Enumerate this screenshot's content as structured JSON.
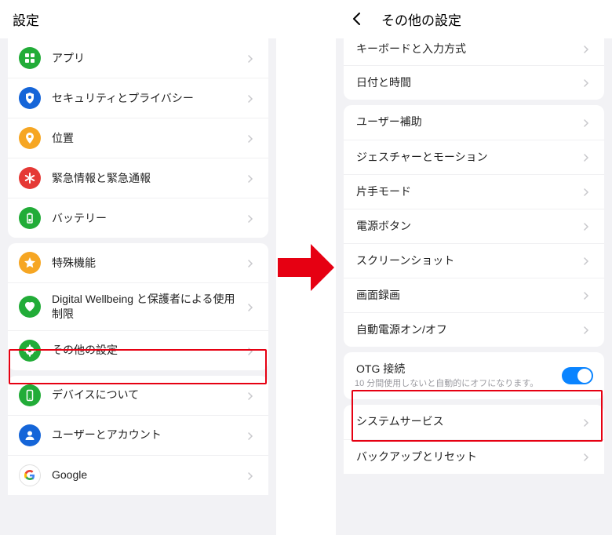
{
  "left": {
    "title": "設定",
    "group1": [
      {
        "icon": "apps",
        "color": "#22ac38",
        "label": "アプリ"
      },
      {
        "icon": "shield",
        "color": "#1565d8",
        "label": "セキュリティとプライバシー"
      },
      {
        "icon": "pin",
        "color": "#f6a623",
        "label": "位置"
      },
      {
        "icon": "asterisk",
        "color": "#e53935",
        "label": "緊急情報と緊急通報"
      },
      {
        "icon": "battery",
        "color": "#22ac38",
        "label": "バッテリー"
      }
    ],
    "group2": [
      {
        "icon": "star",
        "color": "#f6a623",
        "label": "特殊機能"
      },
      {
        "icon": "heart",
        "color": "#22ac38",
        "label": "Digital Wellbeing と保護者による使用制限"
      },
      {
        "icon": "gear",
        "color": "#22ac38",
        "label": "その他の設定"
      }
    ],
    "group3": [
      {
        "icon": "phone",
        "color": "#22ac38",
        "label": "デバイスについて"
      },
      {
        "icon": "user",
        "color": "#1565d8",
        "label": "ユーザーとアカウント"
      },
      {
        "icon": "google",
        "color": "#ffffff",
        "label": "Google"
      }
    ]
  },
  "right": {
    "title": "その他の設定",
    "group0": [
      {
        "label": "キーボードと入力方式"
      },
      {
        "label": "日付と時間"
      }
    ],
    "group1": [
      {
        "label": "ユーザー補助"
      },
      {
        "label": "ジェスチャーとモーション"
      },
      {
        "label": "片手モード"
      },
      {
        "label": "電源ボタン"
      },
      {
        "label": "スクリーンショット"
      },
      {
        "label": "画面録画"
      },
      {
        "label": "自動電源オン/オフ"
      }
    ],
    "group2_title": "OTG 接続",
    "group2_sub": "10 分間使用しないと自動的にオフになります。",
    "group3": [
      {
        "label": "システムサービス"
      },
      {
        "label": "バックアップとリセット"
      }
    ]
  }
}
